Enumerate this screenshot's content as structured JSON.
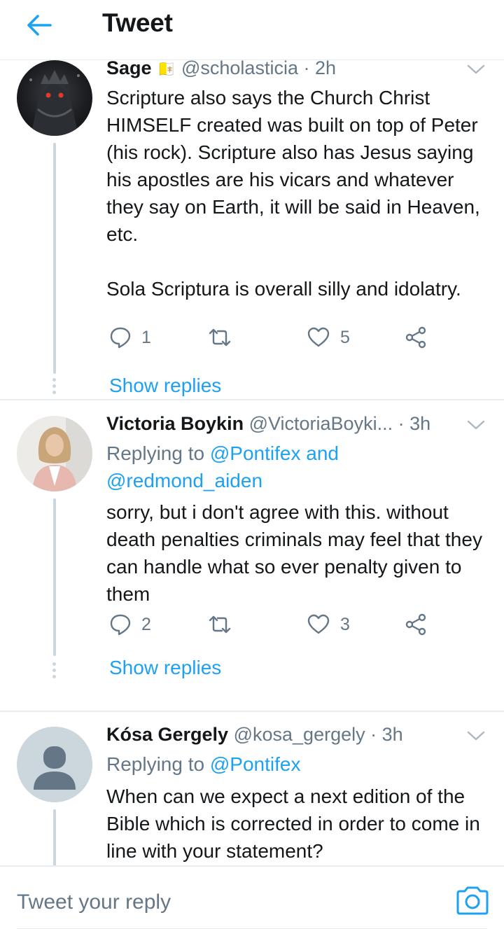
{
  "header": {
    "title": "Tweet"
  },
  "tweets": [
    {
      "name": "Sage",
      "flag": "🇻🇦",
      "handle": "@scholasticia",
      "time": "· 2h",
      "replying_prefix": "",
      "replying_to_1": "",
      "replying_and": "",
      "replying_to_2": "",
      "text": "Scripture also says the Church Christ HIMSELF created was built on top of Peter (his rock). Scripture also has Jesus saying his apostles are his vicars and whatever they say on Earth, it will be said in Heaven, etc.\n\nSola Scriptura is overall silly and idolatry.",
      "replies": "1",
      "retweets": "",
      "likes": "5",
      "show_replies": "Show replies"
    },
    {
      "name": "Victoria Boykin",
      "handle": "@VictoriaBoyki...",
      "time": "· 3h",
      "replying_prefix": "Replying to",
      "replying_to_1": "@Pontifex",
      "replying_and": "and",
      "replying_to_2": "@redmond_aiden",
      "text": "sorry, but i don't agree with this. without death penalties criminals may feel that they can handle what so ever penalty given to them",
      "replies": "2",
      "retweets": "",
      "likes": "3",
      "show_replies": "Show replies"
    },
    {
      "name": "Kósa Gergely",
      "handle": "@kosa_gergely",
      "time": "· 3h",
      "replying_prefix": "Replying to",
      "replying_to_1": "@Pontifex",
      "text": "When can we expect a next edition of the Bible which is corrected in order to come in line with your statement?"
    }
  ],
  "composer": {
    "placeholder": "Tweet your reply"
  },
  "colors": {
    "accent": "#1da1f2",
    "secondary_text": "#657786",
    "divider": "#e6ecf0"
  },
  "icons": [
    "back-arrow-icon",
    "chevron-down-icon",
    "reply-icon",
    "retweet-icon",
    "like-icon",
    "share-icon",
    "camera-icon",
    "default-avatar-icon"
  ]
}
